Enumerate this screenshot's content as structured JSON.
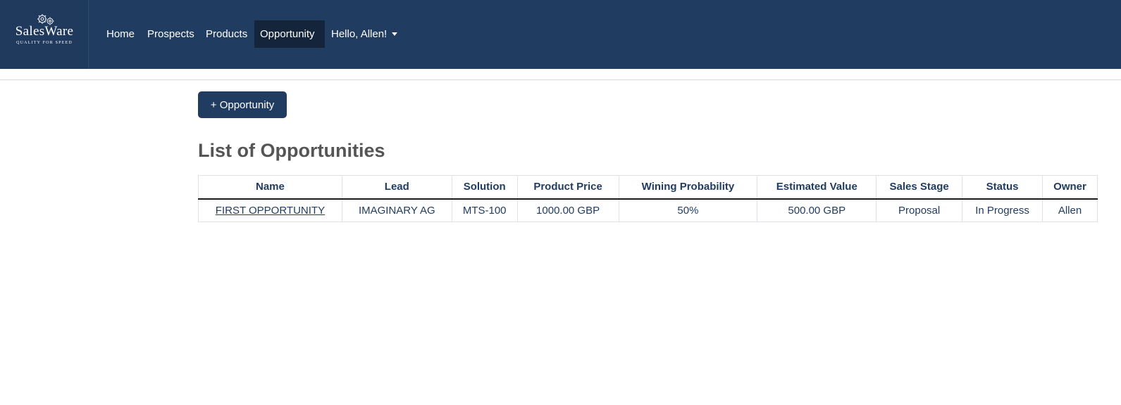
{
  "brand": {
    "name": "SalesWare",
    "tagline": "QUALITY FOR SPEED",
    "logo_icon": "gear-icon"
  },
  "nav": {
    "items": [
      {
        "label": "Home"
      },
      {
        "label": "Prospects"
      },
      {
        "label": "Products"
      },
      {
        "label": "Opportunity",
        "active": true
      }
    ],
    "user_menu": {
      "label": "Hello, Allen!",
      "icon": "caret-down-icon"
    }
  },
  "actions": {
    "add_label": "+ Opportunity"
  },
  "page": {
    "title": "List of Opportunities"
  },
  "table": {
    "columns": [
      "Name",
      "Lead",
      "Solution",
      "Product Price",
      "Wining Probability",
      "Estimated Value",
      "Sales Stage",
      "Status",
      "Owner"
    ],
    "rows": [
      [
        "FIRST OPPORTUNITY",
        "IMAGINARY AG",
        "MTS-100",
        "1000.00 GBP",
        "50%",
        "500.00 GBP",
        "Proposal",
        "In Progress",
        "Allen"
      ]
    ]
  },
  "colors": {
    "navbar": "#213c61",
    "active_nav": "#13243b",
    "title_text": "#555555",
    "table_text": "#213c61"
  }
}
